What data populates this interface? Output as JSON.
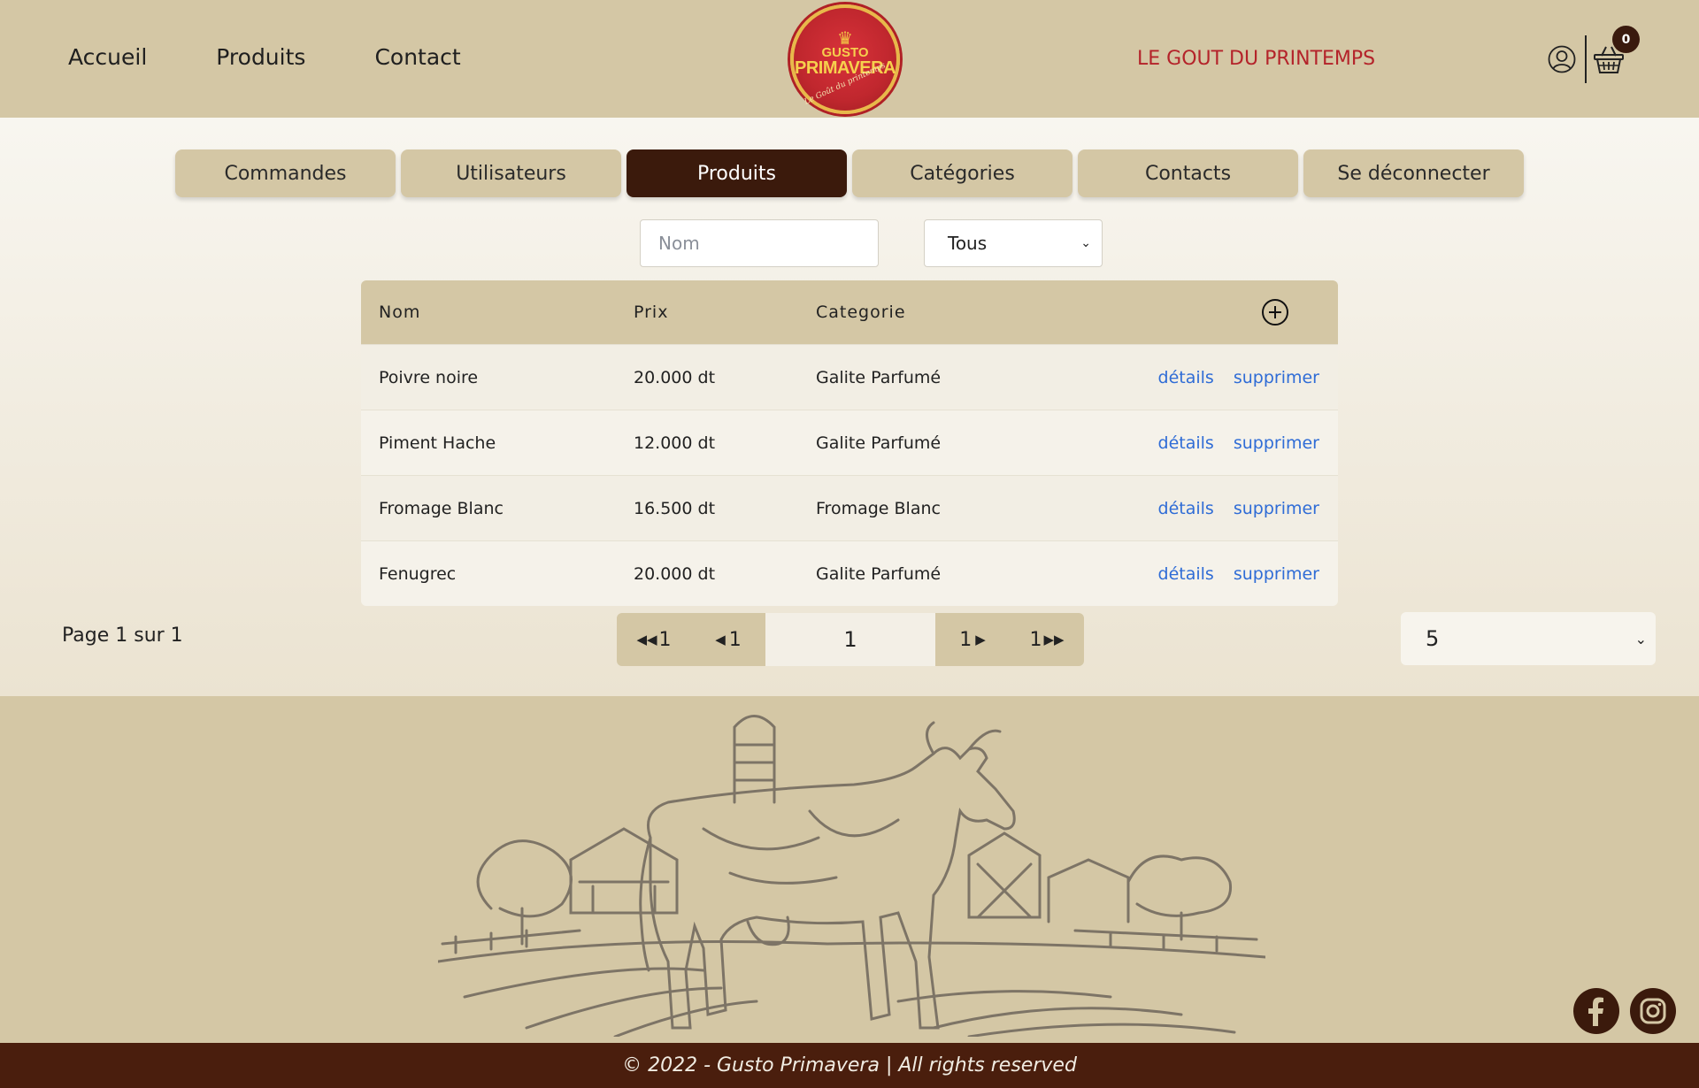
{
  "header": {
    "nav": [
      "Accueil",
      "Produits",
      "Contact"
    ],
    "logo": {
      "line1": "GUSTO",
      "line2": "PRIMAVERA",
      "line3": "Le Goût du printemps"
    },
    "slogan": "LE GOUT DU PRINTEMPS",
    "cart_count": "0",
    "icons": {
      "user": "user-icon",
      "cart": "basket-icon"
    }
  },
  "tabs": [
    {
      "label": "Commandes",
      "active": false
    },
    {
      "label": "Utilisateurs",
      "active": false
    },
    {
      "label": "Produits",
      "active": true
    },
    {
      "label": "Catégories",
      "active": false
    },
    {
      "label": "Contacts",
      "active": false
    },
    {
      "label": "Se déconnecter",
      "active": false
    }
  ],
  "filters": {
    "name_placeholder": "Nom",
    "name_value": "",
    "category_selected": "Tous"
  },
  "table": {
    "columns": [
      "Nom",
      "Prix",
      "Categorie"
    ],
    "rows": [
      {
        "nom": "Poivre noire",
        "prix": "20.000 dt",
        "categorie": "Galite Parfumé"
      },
      {
        "nom": "Piment Hache",
        "prix": "12.000 dt",
        "categorie": "Galite Parfumé"
      },
      {
        "nom": "Fromage Blanc",
        "prix": "16.500 dt",
        "categorie": "Fromage Blanc"
      },
      {
        "nom": "Fenugrec",
        "prix": "20.000 dt",
        "categorie": "Galite Parfumé"
      }
    ],
    "details_label": "détails",
    "delete_label": "supprimer"
  },
  "pagination": {
    "info": "Page 1 sur 1",
    "first": "1",
    "prev": "1",
    "current": "1",
    "next": "1",
    "last": "1",
    "per_page": "5"
  },
  "footer": {
    "copyright": "© 2022 - Gusto Primavera | All rights reserved",
    "social": [
      "facebook-icon",
      "instagram-icon"
    ]
  },
  "colors": {
    "header_bg": "#d4c7a5",
    "active_tab": "#3b1a0c",
    "accent_red": "#b4232a",
    "link": "#2f6cd6",
    "footer_bar": "#4a1e0d"
  }
}
